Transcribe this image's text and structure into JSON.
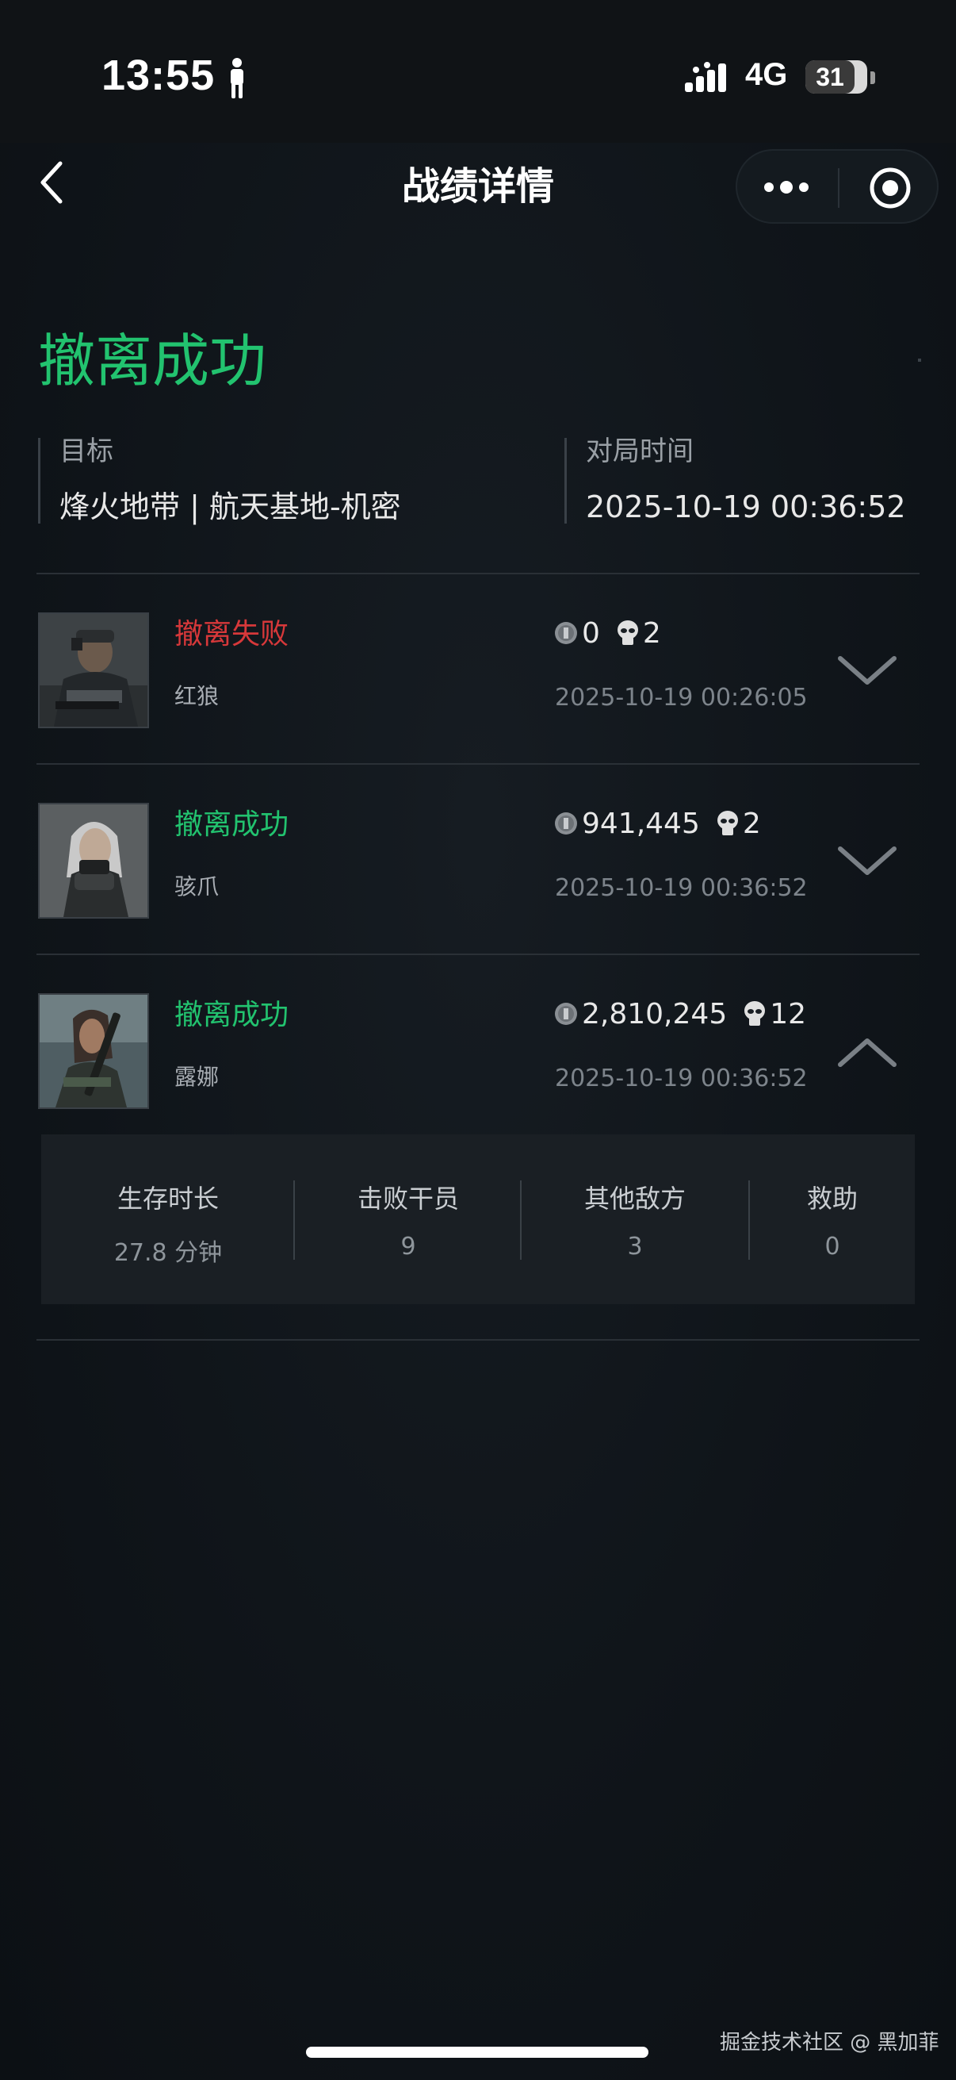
{
  "status_bar": {
    "time": "13:55",
    "network": "4G",
    "battery": "31"
  },
  "nav": {
    "title": "战绩详情"
  },
  "summary": {
    "status": "撤离成功",
    "target_label": "目标",
    "target_value": "烽火地带 | 航天基地-机密",
    "time_label": "对局时间",
    "time_value": "2025-10-19 00:36:52"
  },
  "records": [
    {
      "status": "撤离失败",
      "result": "fail",
      "operator": "红狼",
      "value": "0",
      "kills": "2",
      "time": "2025-10-19 00:26:05",
      "expanded": false
    },
    {
      "status": "撤离成功",
      "result": "ok",
      "operator": "骇爪",
      "value": "941,445",
      "kills": "2",
      "time": "2025-10-19 00:36:52",
      "expanded": false
    },
    {
      "status": "撤离成功",
      "result": "ok",
      "operator": "露娜",
      "value": "2,810,245",
      "kills": "12",
      "time": "2025-10-19 00:36:52",
      "expanded": true
    }
  ],
  "detail": [
    {
      "label": "生存时长",
      "value": "27.8 分钟"
    },
    {
      "label": "击败干员",
      "value": "9"
    },
    {
      "label": "其他敌方",
      "value": "3"
    },
    {
      "label": "救助",
      "value": "0"
    }
  ],
  "watermark": "掘金技术社区 @ 黑加菲",
  "colors": {
    "success": "#22c36f",
    "fail": "#d7383a",
    "background": "#0f1419"
  },
  "icons": [
    "back-icon",
    "more-icon",
    "target-icon",
    "coin-icon",
    "skull-icon",
    "chevron-down-icon",
    "chevron-up-icon"
  ]
}
